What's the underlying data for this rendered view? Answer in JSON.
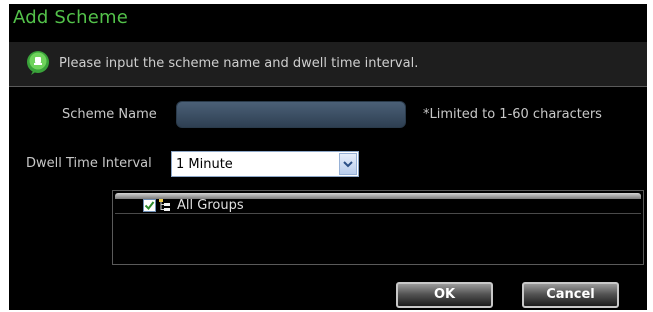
{
  "dialog": {
    "title": "Add Scheme",
    "info_message": "Please input the scheme name and dwell time interval.",
    "info_icon": "speech-bubble-icon"
  },
  "form": {
    "scheme_name_label": "Scheme Name",
    "scheme_name_value": "",
    "scheme_name_hint": "*Limited to 1-60 characters",
    "dwell_label": "Dwell Time Interval",
    "dwell_value": "1 Minute"
  },
  "tree": {
    "root_label": "All Groups",
    "root_checked": true
  },
  "buttons": {
    "ok": "OK",
    "cancel": "Cancel"
  },
  "colors": {
    "title": "#53c24a",
    "background": "#000000",
    "input_fill": "#3d5066"
  }
}
